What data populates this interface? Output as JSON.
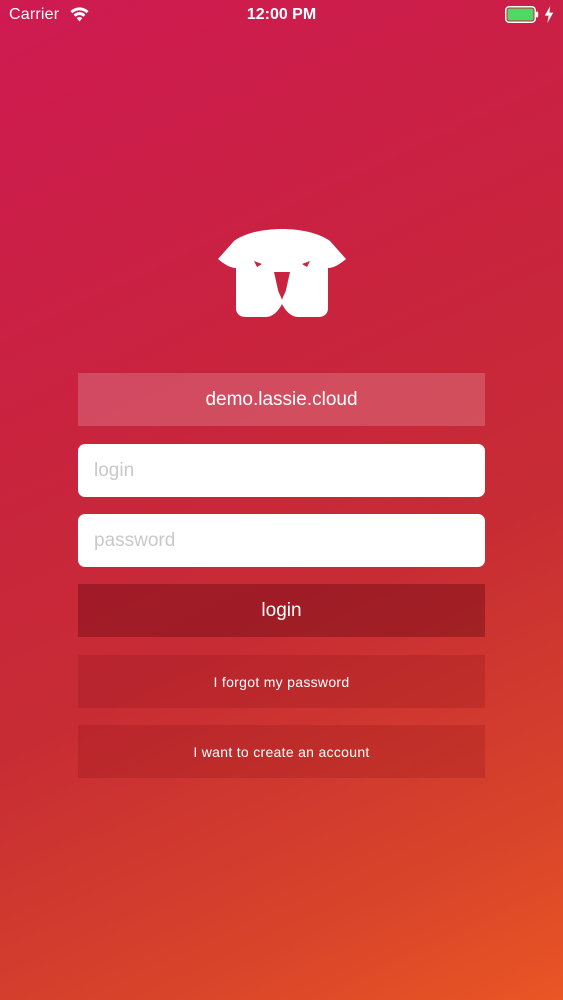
{
  "status_bar": {
    "carrier": "Carrier",
    "time": "12:00 PM",
    "battery_level": 1.0,
    "battery_color": "#4cd964",
    "charging": true
  },
  "logo": {
    "icon": "dog-head-icon"
  },
  "form": {
    "server": "demo.lassie.cloud",
    "login_placeholder": "login",
    "login_value": "",
    "password_placeholder": "password",
    "password_value": "",
    "login_button_label": "login",
    "forgot_password_label": "I forgot my password",
    "create_account_label": "I want to create an account"
  },
  "colors": {
    "gradient_start": "#cf1a52",
    "gradient_end": "#ea5624"
  }
}
